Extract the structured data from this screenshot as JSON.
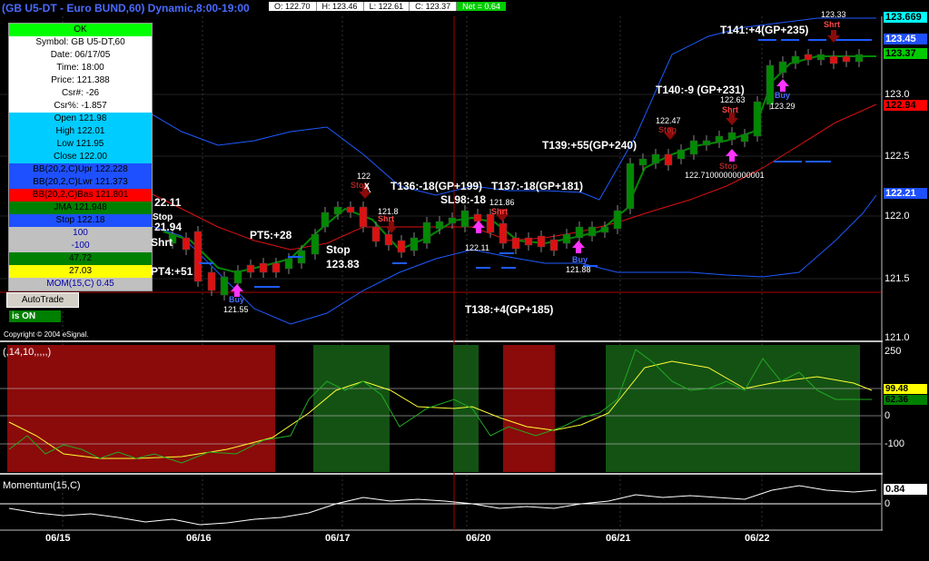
{
  "title": "(GB U5-DT - Euro BUND,60) Dynamic,8:00-19:00",
  "ohlc": {
    "open": "O: 122.70",
    "high": "H: 123.46",
    "low": "L: 122.61",
    "close": "C: 123.37",
    "net": "Net = 0.64"
  },
  "cursor_window": {
    "rows": [
      {
        "text": "OK",
        "bg": "#00ff00",
        "fg": "#000000"
      },
      {
        "text": "Symbol: GB U5-DT,60",
        "bg": "#ffffff",
        "fg": "#000000"
      },
      {
        "text": "Date: 06/17/05",
        "bg": "#ffffff",
        "fg": "#000000"
      },
      {
        "text": "Time: 18:00",
        "bg": "#ffffff",
        "fg": "#000000"
      },
      {
        "text": "Price: 121.388",
        "bg": "#ffffff",
        "fg": "#000000"
      },
      {
        "text": "Csr#: -26",
        "bg": "#ffffff",
        "fg": "#000000"
      },
      {
        "text": "Csr%: -1.857",
        "bg": "#ffffff",
        "fg": "#000000"
      },
      {
        "text": "Open 121.98",
        "bg": "#00ccff",
        "fg": "#000000"
      },
      {
        "text": "High 122.01",
        "bg": "#00ccff",
        "fg": "#000000"
      },
      {
        "text": "Low 121.95",
        "bg": "#00ccff",
        "fg": "#000000"
      },
      {
        "text": "Close 122.00",
        "bg": "#00ccff",
        "fg": "#000000"
      },
      {
        "text": "BB(20,2,C)Upr 122.228",
        "bg": "#1e50ff",
        "fg": "#000000"
      },
      {
        "text": "BB(20,2,C)Lwr 121.373",
        "bg": "#1e50ff",
        "fg": "#000000"
      },
      {
        "text": "BB(20,2,C)Bas 121.801",
        "bg": "#ff0000",
        "fg": "#000000"
      },
      {
        "text": "JMA 121.948",
        "bg": "#008000",
        "fg": "#000000"
      },
      {
        "text": "Stop 122.18",
        "bg": "#1e50ff",
        "fg": "#000000"
      },
      {
        "text": "100",
        "bg": "#c0c0c0",
        "fg": "#0000aa"
      },
      {
        "text": "-100",
        "bg": "#c0c0c0",
        "fg": "#0000aa"
      },
      {
        "text": "47.72",
        "bg": "#008000",
        "fg": "#000000"
      },
      {
        "text": "27.03",
        "bg": "#ffff00",
        "fg": "#000000"
      },
      {
        "text": "MOM(15,C) 0.45",
        "bg": "#c0c0c0",
        "fg": "#0000aa"
      }
    ]
  },
  "autotrade": {
    "button": "AutoTrade",
    "status": "is ON"
  },
  "copyright": "Copyright © 2004 eSignal.",
  "price_axis": {
    "ticks": [
      "123.0",
      "122.5",
      "122.0",
      "121.5",
      "121.0"
    ],
    "labels": [
      {
        "text": "123.669",
        "bg": "#00ffff",
        "fg": "#000000"
      },
      {
        "text": "123.45",
        "bg": "#1e50ff",
        "fg": "#ffffff"
      },
      {
        "text": "123.37",
        "bg": "#00cc00",
        "fg": "#000000"
      },
      {
        "text": "122.94",
        "bg": "#ff0000",
        "fg": "#000000"
      },
      {
        "text": "122.21",
        "bg": "#1e50ff",
        "fg": "#ffffff"
      }
    ]
  },
  "cci_panel": {
    "header": "(,14,10,,,,,)",
    "ticks": [
      "250",
      "100",
      "0",
      "-100"
    ],
    "labels": [
      {
        "text": "99.48",
        "bg": "#ffff00",
        "fg": "#000000"
      },
      {
        "text": "62.36",
        "bg": "#008000",
        "fg": "#000000"
      }
    ]
  },
  "mom_panel": {
    "header": "Momentum(15,C)",
    "ticks": [
      "0"
    ],
    "labels": [
      {
        "text": "0.84",
        "bg": "#ffffff",
        "fg": "#000000"
      }
    ]
  },
  "dates": [
    "06/15",
    "06/16",
    "06/17",
    "06/20",
    "06/21",
    "06/22"
  ],
  "annotations": {
    "t141": "T141:+4(GP+235)",
    "t140": "T140:-9 (GP+231)",
    "t139": "T139:+55(GP+240)",
    "t136": "T136:-18(GP+199)",
    "t137": "T137:-18(GP+181)",
    "t138": "T138:+4(GP+185)",
    "sl98": "SL98:-18",
    "pt5": "PT5:+28",
    "pt4": "PT4:+51",
    "stop": "Stop",
    "stopval": "123.83",
    "v2211": "22.11",
    "v2194": "21.94",
    "stop_l": "Stop",
    "shrt_l": "Shrt",
    "p12333": "123.33",
    "p12329": "123.29",
    "p12247": "122.47",
    "p12263": "122.63",
    "p1227": "122.71000000000001",
    "p122": "122",
    "p1218": "121.8",
    "p12211": "122.11",
    "p12186": "121.86",
    "p12188": "121.88",
    "p12155": "121.55",
    "shrt": "Shrt",
    "buy": "Buy",
    "stoplbl": "Stop",
    "x": "X"
  }
}
